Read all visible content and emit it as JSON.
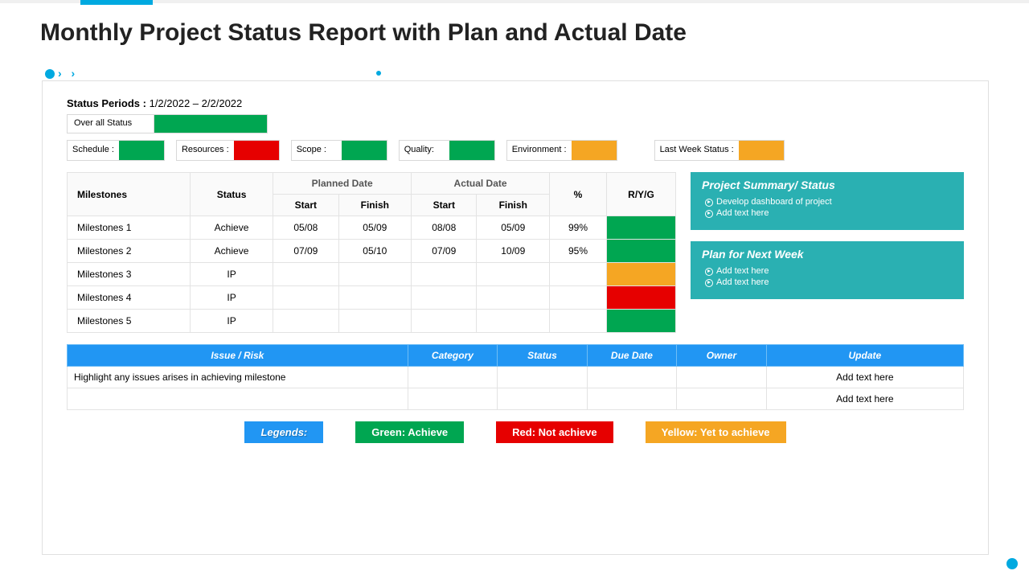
{
  "title": "Monthly Project Status Report with Plan and Actual Date",
  "status_period_label": "Status Periods :",
  "status_period_value": "1/2/2022 – 2/2/2022",
  "overall_label": "Over all Status",
  "overall_color": "green",
  "metrics": [
    {
      "label": "Schedule :",
      "color": "green"
    },
    {
      "label": "Resources :",
      "color": "red"
    },
    {
      "label": "Scope :",
      "color": "green"
    },
    {
      "label": "Quality:",
      "color": "green"
    },
    {
      "label": "Environment :",
      "color": "orange"
    },
    {
      "label": "Last Week Status :",
      "color": "orange"
    }
  ],
  "table": {
    "milestones_header": "Milestones",
    "status_header": "Status",
    "planned_header": "Planned Date",
    "actual_header": "Actual Date",
    "start_header": "Start",
    "finish_header": "Finish",
    "pct_header": "%",
    "ryg_header": "R/Y/G",
    "rows": [
      {
        "name": "Milestones 1",
        "status": "Achieve",
        "pstart": "05/08",
        "pfinish": "05/09",
        "astart": "08/08",
        "afinish": "05/09",
        "pct": "99%",
        "ryg": "green"
      },
      {
        "name": "Milestones 2",
        "status": "Achieve",
        "pstart": "07/09",
        "pfinish": "05/10",
        "astart": "07/09",
        "afinish": "10/09",
        "pct": "95%",
        "ryg": "green"
      },
      {
        "name": "Milestones 3",
        "status": "IP",
        "pstart": "",
        "pfinish": "",
        "astart": "",
        "afinish": "",
        "pct": "",
        "ryg": "orange"
      },
      {
        "name": "Milestones 4",
        "status": "IP",
        "pstart": "",
        "pfinish": "",
        "astart": "",
        "afinish": "",
        "pct": "",
        "ryg": "red"
      },
      {
        "name": "Milestones 5",
        "status": "IP",
        "pstart": "",
        "pfinish": "",
        "astart": "",
        "afinish": "",
        "pct": "",
        "ryg": "green"
      }
    ]
  },
  "summary_card": {
    "title": "Project  Summary/ Status",
    "items": [
      "Develop  dashboard  of project",
      "Add text here"
    ]
  },
  "plan_card": {
    "title": "Plan for Next Week",
    "items": [
      "Add text here",
      "Add text here"
    ]
  },
  "issues": {
    "headers": [
      "Issue / Risk",
      "Category",
      "Status",
      "Due Date",
      "Owner",
      "Update"
    ],
    "rows": [
      {
        "issue": "Highlight  any  issues arises  in achieving  milestone",
        "category": "",
        "status": "",
        "due": "",
        "owner": "",
        "update": "Add text here"
      },
      {
        "issue": "",
        "category": "",
        "status": "",
        "due": "",
        "owner": "",
        "update": "Add text here"
      }
    ]
  },
  "legends": {
    "title": "Legends:",
    "green": "Green:  Achieve",
    "red": "Red: Not achieve",
    "yellow": "Yellow:  Yet to achieve"
  }
}
